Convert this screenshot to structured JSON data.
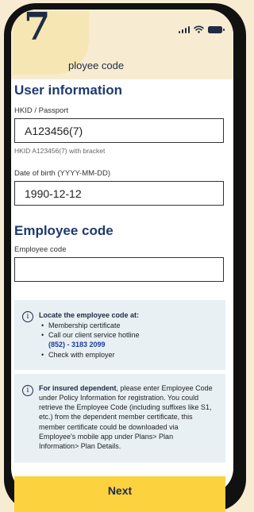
{
  "header": {
    "step_number": "7",
    "title": "ployee code"
  },
  "user_info": {
    "heading": "User information",
    "id_label": "HKID / Passport",
    "id_value": "A123456(7)",
    "id_hint": "HKID A123456(7) with bracket",
    "dob_label": "Date of birth (YYYY-MM-DD)",
    "dob_value": "1990-12-12"
  },
  "employee": {
    "heading": "Employee code",
    "code_label": "Employee code",
    "code_value": ""
  },
  "info1": {
    "title": "Locate the employee code at:",
    "items": [
      "Membership certificate",
      "Call our client service hotline",
      "Check with employer"
    ],
    "hotline": "(852) - 3183 2099"
  },
  "info2": {
    "bold": "For insured dependent",
    "text": ", please enter Employee Code under Policy Information for registration. You could retrieve the Employee Code (including suffixes like S1, etc.) from the dependent member certificate, this member certificate could be downloaded via Employee's mobile app under Plans> Plan Information> Plan Details."
  },
  "next_label": "Next",
  "icons": {
    "info": "info-icon",
    "signal": "signal-icon",
    "wifi": "wifi-icon",
    "battery": "battery-icon"
  },
  "colors": {
    "accent": "#fcd23f",
    "heading": "#1f3a6d",
    "info_bg": "#e8f0f4",
    "header_bg": "#f7ecd2"
  }
}
